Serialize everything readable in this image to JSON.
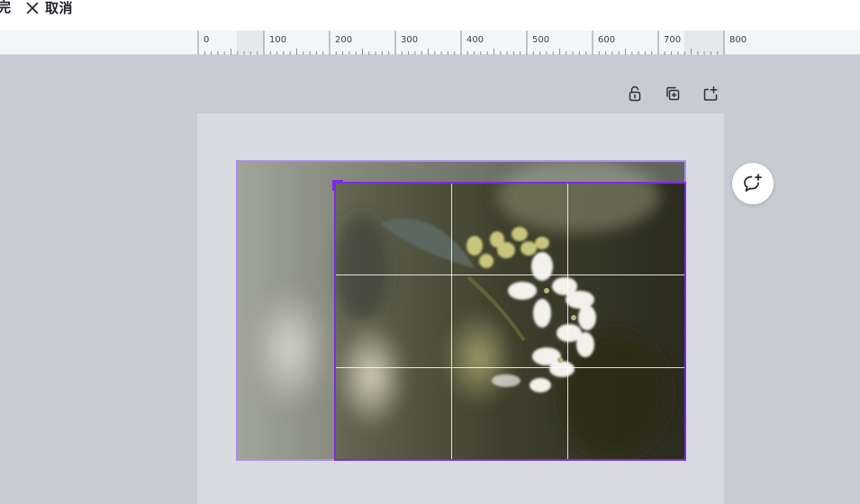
{
  "toolbar": {
    "partial_text": "完",
    "cancel_label": "取消"
  },
  "ruler": {
    "ticks": [
      "0",
      "100",
      "200",
      "300",
      "400",
      "500",
      "600",
      "700",
      "800"
    ]
  },
  "icons": {
    "cancel": "close-icon",
    "lock": "lock-icon",
    "duplicate": "duplicate-icon",
    "add_page": "add-page-icon",
    "comment": "add-comment-icon"
  },
  "colors": {
    "accent": "#7d2ae8",
    "canvas_bg": "#c7cbd3",
    "page_bg": "#d9dadf"
  }
}
